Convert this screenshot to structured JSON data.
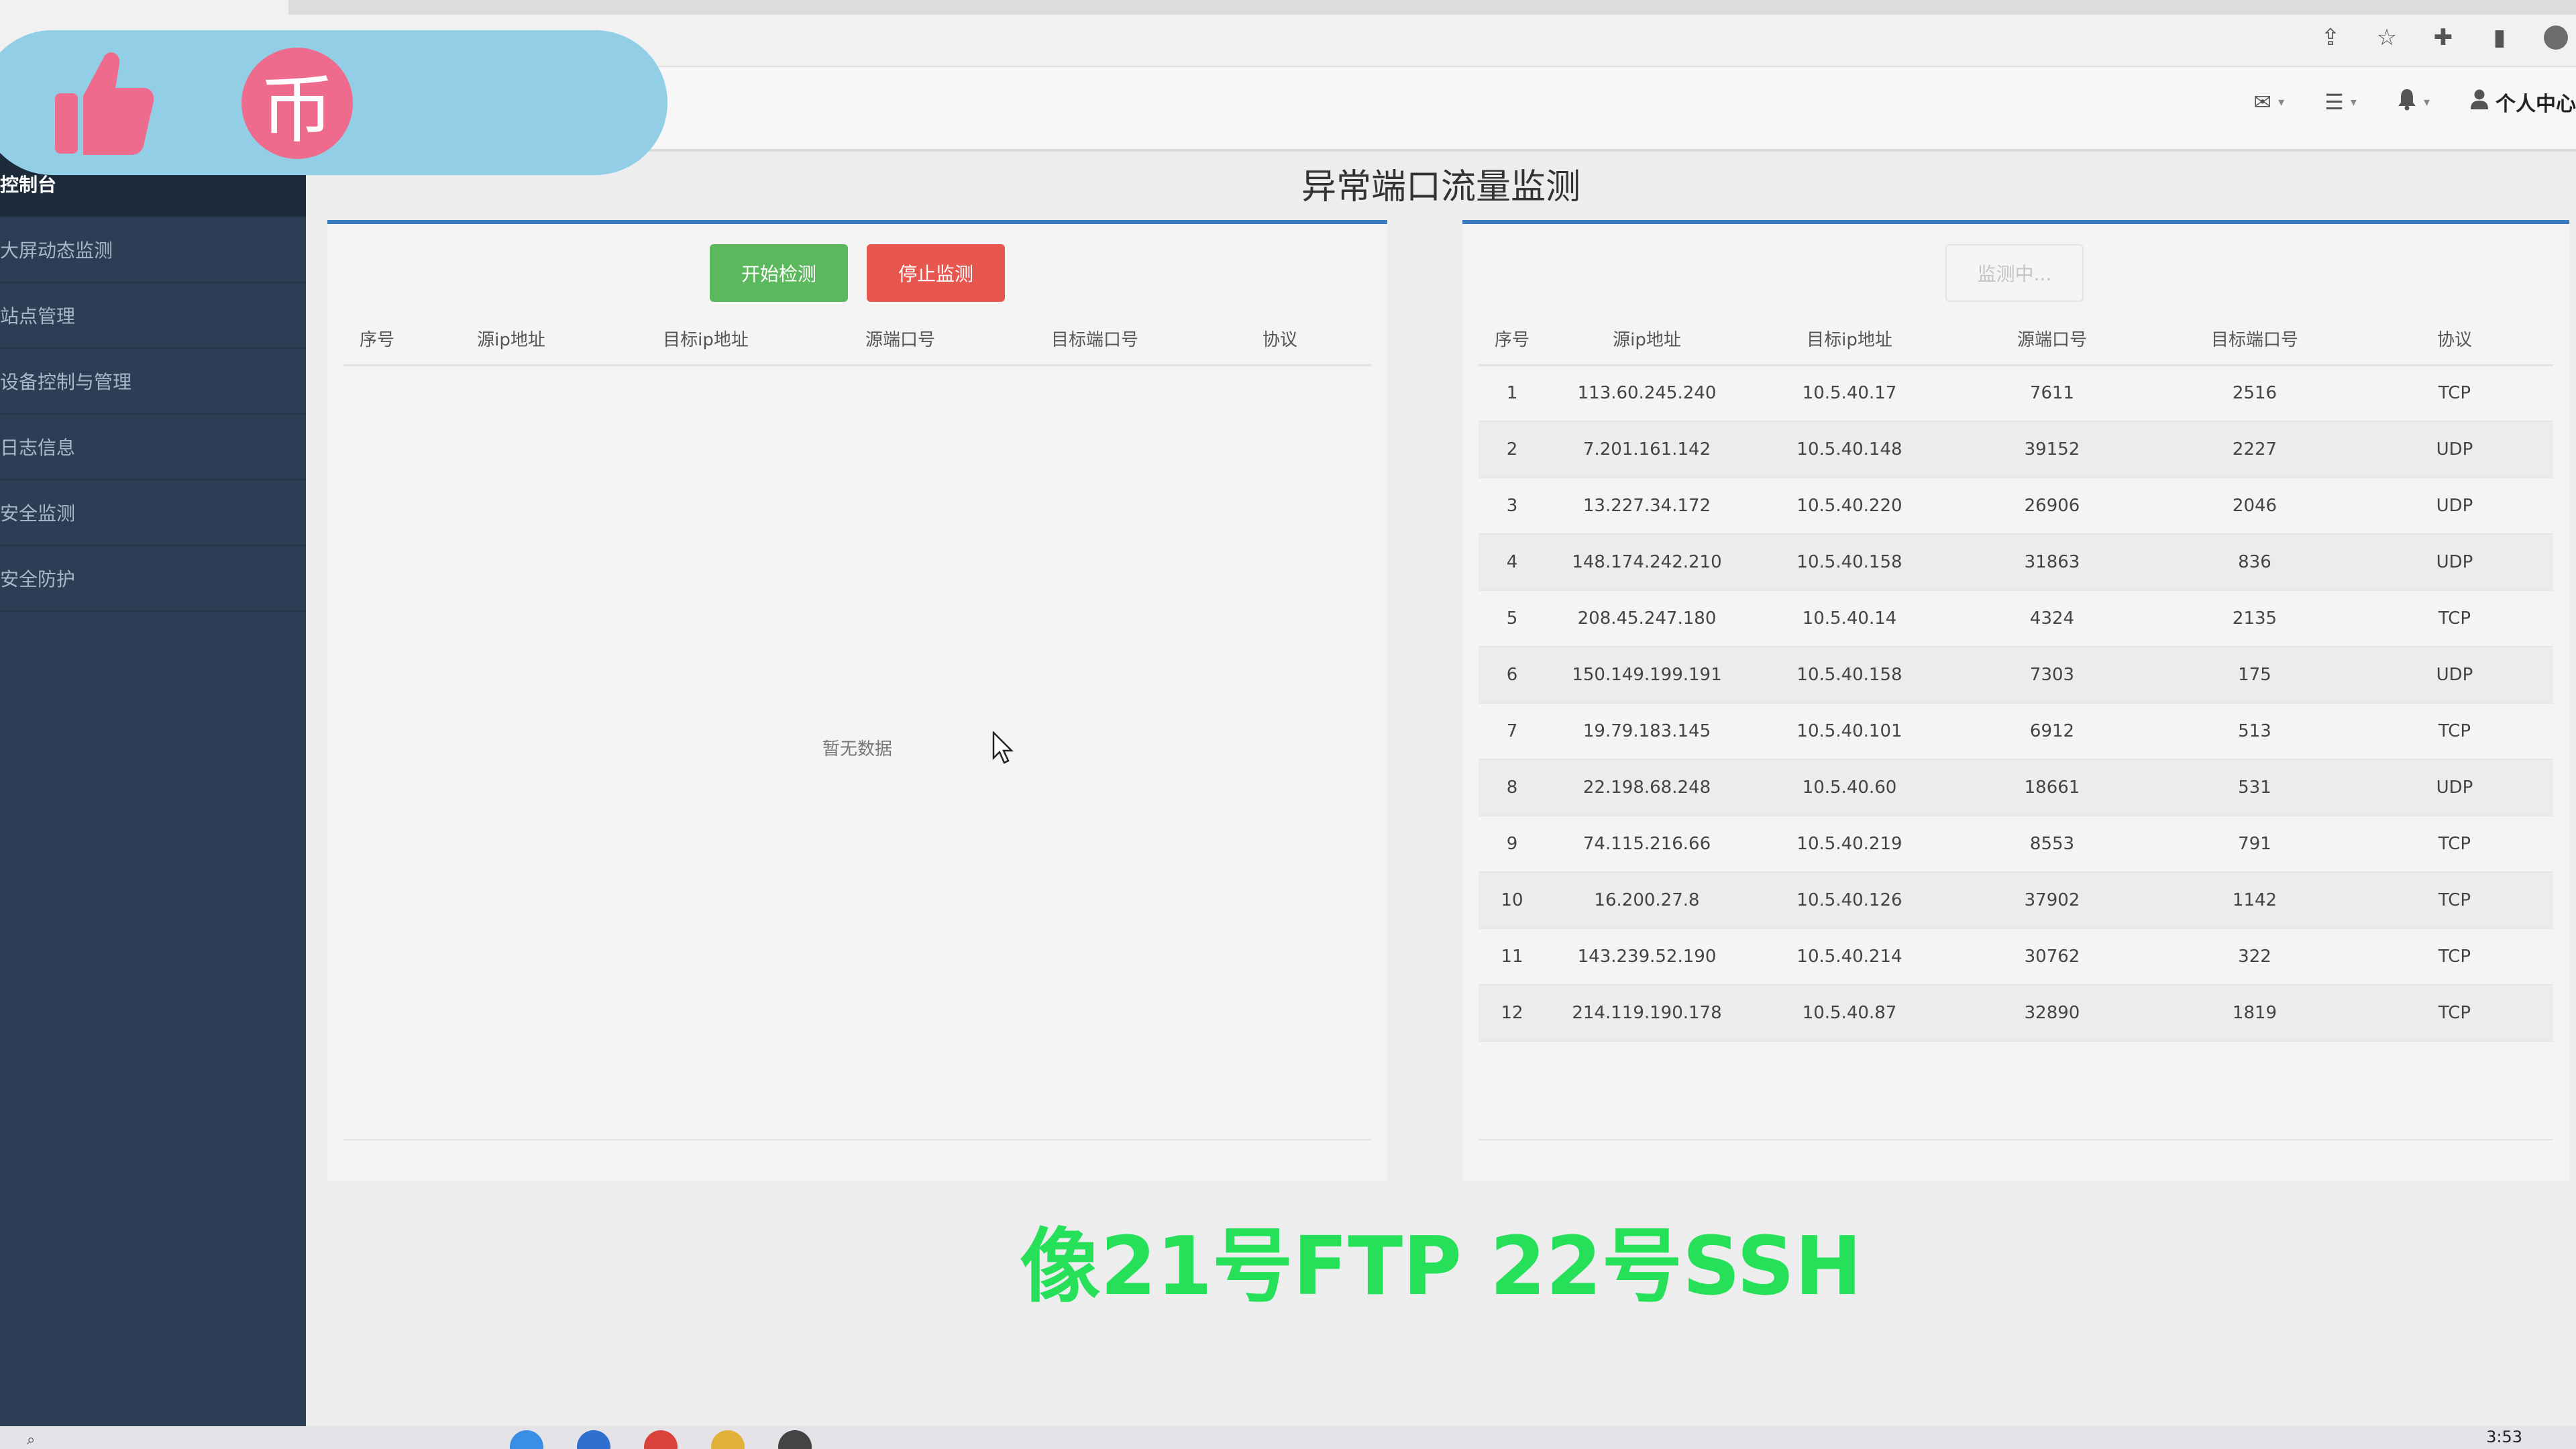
{
  "header": {
    "tools": [
      {
        "icon": "mail-icon",
        "glyph": "✉"
      },
      {
        "icon": "list-icon",
        "glyph": "☰"
      },
      {
        "icon": "bell-icon",
        "glyph": "🔔"
      }
    ],
    "user_label": "个人中心"
  },
  "sidebar": {
    "items": [
      {
        "label": "控制台",
        "active": true
      },
      {
        "label": "大屏动态监测"
      },
      {
        "label": "站点管理"
      },
      {
        "label": "设备控制与管理"
      },
      {
        "label": "日志信息"
      },
      {
        "label": "安全监测"
      },
      {
        "label": "安全防护"
      }
    ]
  },
  "page": {
    "title": "异常端口流量监测"
  },
  "left_panel": {
    "start_button": "开始检测",
    "stop_button": "停止监测",
    "columns": [
      "序号",
      "源ip地址",
      "目标ip地址",
      "源端口号",
      "目标端口号",
      "协议"
    ],
    "empty_text": "暂无数据"
  },
  "right_panel": {
    "status_button": "监测中...",
    "columns": [
      "序号",
      "源ip地址",
      "目标ip地址",
      "源端口号",
      "目标端口号",
      "协议"
    ],
    "rows": [
      [
        "1",
        "113.60.245.240",
        "10.5.40.17",
        "7611",
        "2516",
        "TCP"
      ],
      [
        "2",
        "7.201.161.142",
        "10.5.40.148",
        "39152",
        "2227",
        "UDP"
      ],
      [
        "3",
        "13.227.34.172",
        "10.5.40.220",
        "26906",
        "2046",
        "UDP"
      ],
      [
        "4",
        "148.174.242.210",
        "10.5.40.158",
        "31863",
        "836",
        "UDP"
      ],
      [
        "5",
        "208.45.247.180",
        "10.5.40.14",
        "4324",
        "2135",
        "TCP"
      ],
      [
        "6",
        "150.149.199.191",
        "10.5.40.158",
        "7303",
        "175",
        "UDP"
      ],
      [
        "7",
        "19.79.183.145",
        "10.5.40.101",
        "6912",
        "513",
        "TCP"
      ],
      [
        "8",
        "22.198.68.248",
        "10.5.40.60",
        "18661",
        "531",
        "UDP"
      ],
      [
        "9",
        "74.115.216.66",
        "10.5.40.219",
        "8553",
        "791",
        "TCP"
      ],
      [
        "10",
        "16.200.27.8",
        "10.5.40.126",
        "37902",
        "1142",
        "TCP"
      ],
      [
        "11",
        "143.239.52.190",
        "10.5.40.214",
        "30762",
        "322",
        "TCP"
      ],
      [
        "12",
        "214.119.190.178",
        "10.5.40.87",
        "32890",
        "1819",
        "TCP"
      ]
    ]
  },
  "subtitle": "像21号FTP 22号SSH",
  "taskbar": {
    "clock": "3:53"
  },
  "colors": {
    "sidebar_bg": "#2c3e55",
    "start_button": "#5cb85c",
    "stop_button": "#e8574f",
    "panel_accent": "#3a7cc0",
    "subtitle": "#26e05a"
  }
}
